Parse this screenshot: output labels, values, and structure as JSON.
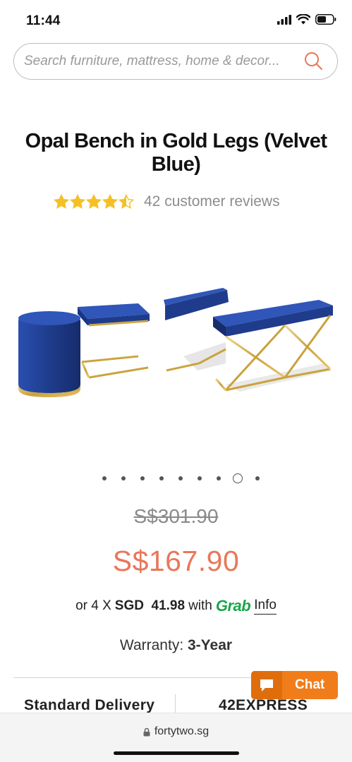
{
  "status_bar": {
    "time": "11:44"
  },
  "search": {
    "placeholder": "Search furniture, mattress, home & decor..."
  },
  "product": {
    "title": "Opal Bench in Gold Legs (Velvet Blue)",
    "rating": 4.5,
    "rating_max": 5,
    "review_text": "42 customer reviews",
    "image_alt": "Opal Bench in Gold Legs (Velvet Blue)",
    "colors": {
      "velvet": "#1f3c8c",
      "gold": "#d4b04a"
    }
  },
  "carousel": {
    "total": 9,
    "active_index": 7
  },
  "pricing": {
    "original_price": "S$301.90",
    "sale_price": "S$167.90",
    "installment_prefix": "or 4 X",
    "installment_amount": "SGD  41.98",
    "installment_with": "with",
    "installment_provider": "Grab",
    "info_label": "Info"
  },
  "warranty": {
    "label": "Warranty:",
    "value": "3-Year"
  },
  "delivery": {
    "label": "Standard Delivery",
    "value": "42EXPRESS"
  },
  "chat": {
    "label": "Chat"
  },
  "browser": {
    "url": "fortytwo.sg"
  },
  "colors": {
    "accent": "#e9775a",
    "chat": "#f07d1a",
    "grab": "#1aa64a",
    "star": "#f5c026"
  }
}
